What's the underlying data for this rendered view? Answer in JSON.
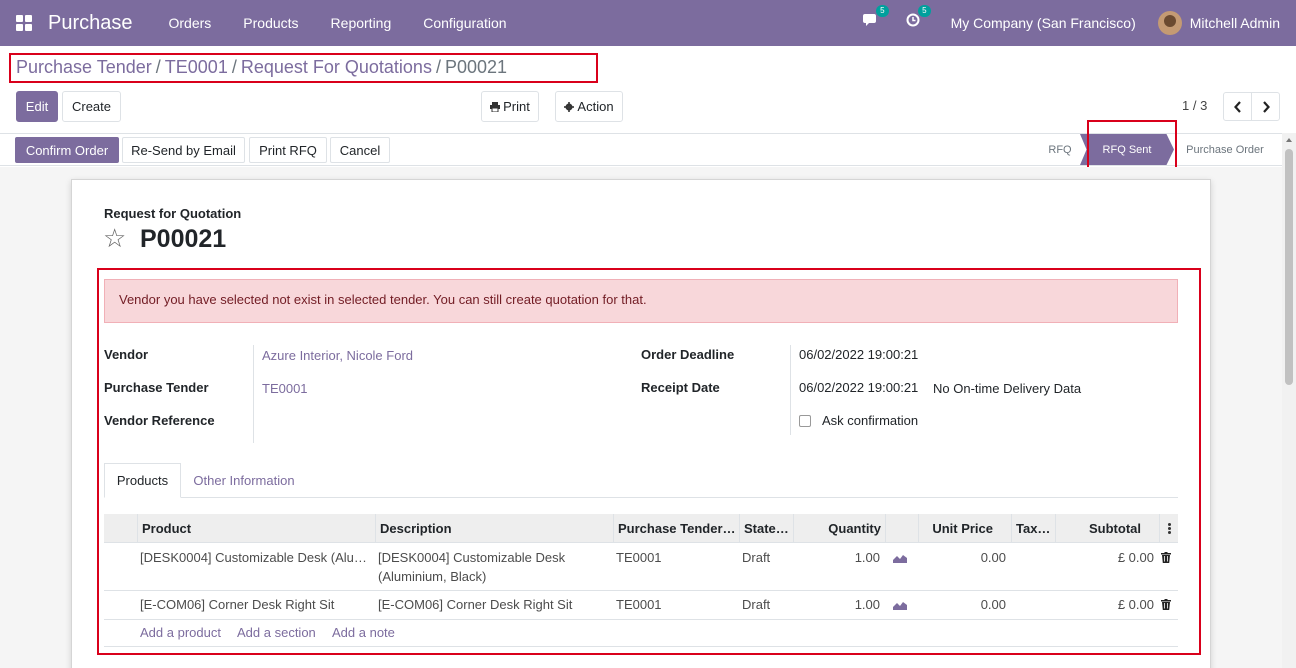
{
  "navbar": {
    "app_name": "Purchase",
    "menu": [
      "Orders",
      "Products",
      "Reporting",
      "Configuration"
    ],
    "messages_badge": "5",
    "activities_badge": "5",
    "company": "My Company (San Francisco)",
    "user": "Mitchell Admin"
  },
  "breadcrumb": {
    "items": [
      "Purchase Tender",
      "TE0001",
      "Request For Quotations"
    ],
    "current": "P00021",
    "separator": "/"
  },
  "toolbar": {
    "edit": "Edit",
    "create": "Create",
    "print": "Print",
    "action": "Action",
    "pager": "1 / 3"
  },
  "statusbar": {
    "buttons": [
      "Confirm Order",
      "Re-Send by Email",
      "Print RFQ",
      "Cancel"
    ],
    "stages": [
      "RFQ",
      "RFQ Sent",
      "Purchase Order"
    ],
    "active_stage": "RFQ Sent"
  },
  "form": {
    "doc_type": "Request for Quotation",
    "name": "P00021",
    "alert": "Vendor you have selected not exist in selected tender. You can still create quotation for that.",
    "fields": {
      "vendor_label": "Vendor",
      "vendor_value": "Azure Interior, Nicole Ford",
      "tender_label": "Purchase Tender",
      "tender_value": "TE0001",
      "vendor_ref_label": "Vendor Reference",
      "deadline_label": "Order Deadline",
      "deadline_value": "06/02/2022 19:00:21",
      "receipt_label": "Receipt Date",
      "receipt_value": "06/02/2022 19:00:21",
      "ontime_text": "No On-time Delivery Data",
      "ask_confirm_label": "Ask confirmation"
    },
    "tabs": [
      "Products",
      "Other Information"
    ]
  },
  "lines": {
    "headers": [
      "Product",
      "Description",
      "Purchase Tender…",
      "State…",
      "Quantity",
      "Unit Price",
      "Tax…",
      "Subtotal"
    ],
    "rows": [
      {
        "product": "[DESK0004] Customizable Desk (Alu…",
        "description": "[DESK0004] Customizable Desk (Aluminium, Black)",
        "tender": "TE0001",
        "state": "Draft",
        "quantity": "1.00",
        "unit_price": "0.00",
        "subtotal": "£ 0.00"
      },
      {
        "product": "[E-COM06] Corner Desk Right Sit",
        "description": "[E-COM06] Corner Desk Right Sit",
        "tender": "TE0001",
        "state": "Draft",
        "quantity": "1.00",
        "unit_price": "0.00",
        "subtotal": "£ 0.00"
      }
    ],
    "add_product": "Add a product",
    "add_section": "Add a section",
    "add_note": "Add a note"
  },
  "colors": {
    "brand": "#7C6C9E",
    "highlight": "#d9001b",
    "alert_bg": "#f8d7da"
  }
}
